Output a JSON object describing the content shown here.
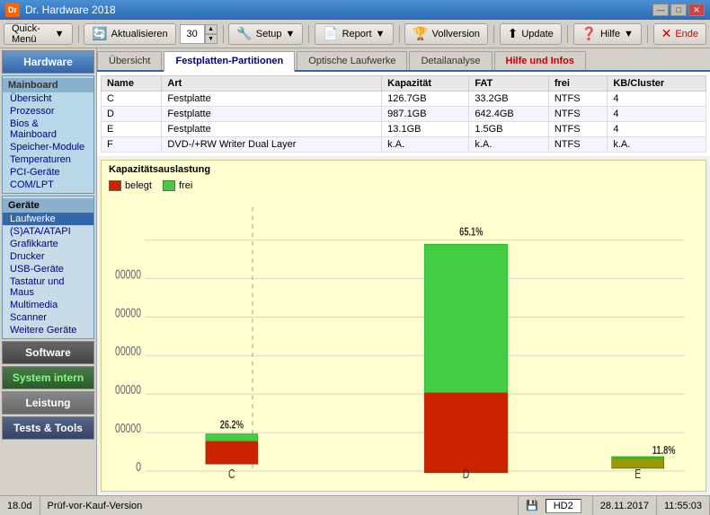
{
  "window": {
    "title": "Dr. Hardware 2018",
    "min_label": "—",
    "max_label": "□",
    "close_label": "✕"
  },
  "toolbar": {
    "quick_menu_label": "Quick-Menü",
    "quick_menu_arrow": "▼",
    "refresh_label": "Aktualisieren",
    "refresh_icon": "🔄",
    "interval_value": "30",
    "setup_label": "Setup",
    "setup_icon": "🔧",
    "report_label": "Report",
    "report_icon": "📄",
    "vollversion_label": "Vollversion",
    "vollversion_icon": "🏆",
    "update_label": "Update",
    "update_icon": "⬆",
    "hilfe_label": "Hilfe",
    "hilfe_icon": "❓",
    "ende_label": "Ende",
    "ende_icon": "✕"
  },
  "sidebar": {
    "hardware_label": "Hardware",
    "mainboard_label": "Mainboard",
    "mainboard_items": [
      "Übersicht",
      "Prozessor",
      "Bios & Mainboard",
      "Speicher-Module",
      "Temperaturen",
      "PCI-Geräte",
      "COM/LPT"
    ],
    "geraete_label": "Geräte",
    "geraete_items": [
      "Laufwerke",
      "(S)ATA/ATAPI",
      "Grafikkarte",
      "Drucker",
      "USB-Geräte",
      "Tastatur und Maus",
      "Multimedia",
      "Scanner",
      "Weitere Geräte"
    ],
    "active_geraete": "Laufwerke",
    "software_label": "Software",
    "system_intern_label": "System intern",
    "leistung_label": "Leistung",
    "tests_tools_label": "Tests & Tools"
  },
  "tabs": {
    "items": [
      "Übersicht",
      "Festplatten-Partitionen",
      "Optische Laufwerke",
      "Detailanalyse",
      "Hilfe und Infos"
    ],
    "active": "Festplatten-Partitionen"
  },
  "table": {
    "headers": [
      "Name",
      "Art",
      "Kapazität",
      "FAT",
      "KB/Cluster"
    ],
    "rows": [
      [
        "C",
        "Festplatte",
        "126.7GB",
        "33.2GB",
        "NTFS",
        "4"
      ],
      [
        "D",
        "Festplatte",
        "987.1GB",
        "642.4GB",
        "NTFS",
        "4"
      ],
      [
        "E",
        "Festplatte",
        "13.1GB",
        "1.5GB",
        "NTFS",
        "4"
      ],
      [
        "F",
        "DVD-/+RW Writer Dual Layer",
        "k.A.",
        "k.A.",
        "NTFS",
        "k.A."
      ]
    ],
    "extra_header": "frei"
  },
  "chart": {
    "title": "Kapazitätsauslastung",
    "legend_belegt": "belegt",
    "legend_frei": "frei",
    "bars": [
      {
        "label": "C",
        "total": 126.7,
        "used": 93.5,
        "free": 33.2,
        "pct_label": "26.2%",
        "pct": 26.2
      },
      {
        "label": "D",
        "total": 987.1,
        "used": 344.7,
        "free": 642.4,
        "pct_label": "65.1%",
        "pct": 65.1
      },
      {
        "label": "E",
        "total": 13.1,
        "used": 11.6,
        "free": 1.5,
        "pct_label": "11.8%",
        "pct": 11.8
      }
    ],
    "colors": {
      "belegt": "#cc2200",
      "frei": "#44cc44",
      "bg": "#ffffd0",
      "border": "#cccc80"
    }
  },
  "statusbar": {
    "version": "18.0d",
    "edition": "Prüf-vor-Kauf-Version",
    "hd_label": "HD2",
    "date": "28.11.2017",
    "time": "11:55:03"
  }
}
